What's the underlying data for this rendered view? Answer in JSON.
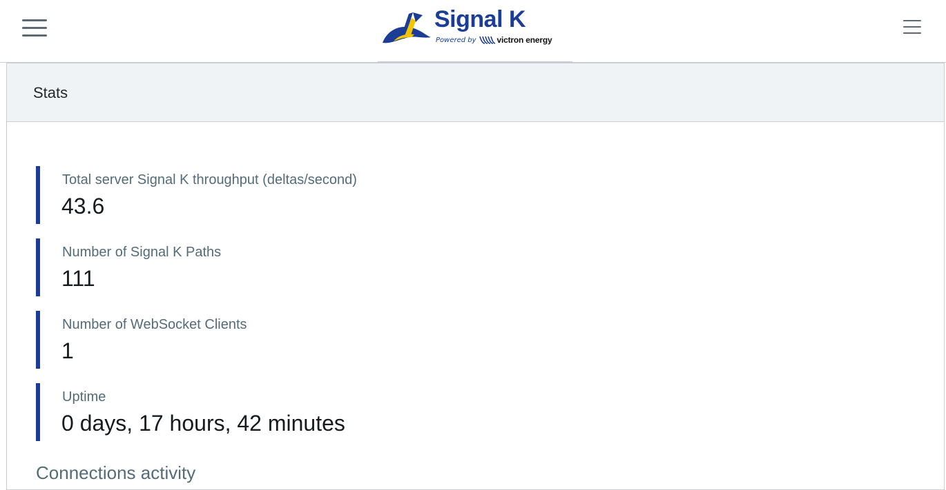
{
  "header": {
    "brand_title": "Signal K",
    "powered_by": "Powered by",
    "partner_name": "victron energy",
    "left_menu_icon": "hamburger-icon",
    "right_menu_icon": "hamburger-icon"
  },
  "card": {
    "title": "Stats",
    "stats": [
      {
        "label": "Total server Signal K throughput (deltas/second)",
        "value": "43.6"
      },
      {
        "label": "Number of Signal K Paths",
        "value": "111"
      },
      {
        "label": "Number of WebSocket Clients",
        "value": "1"
      },
      {
        "label": "Uptime",
        "value": "0 days, 17 hours, 42 minutes"
      }
    ],
    "section_title": "Connections activity"
  },
  "colors": {
    "brand_blue": "#1b3d95",
    "accent_bar": "#1a3b9c",
    "brand_yellow": "#f5c400",
    "muted_text": "#536c79",
    "header_bg": "#f0f3f5"
  }
}
